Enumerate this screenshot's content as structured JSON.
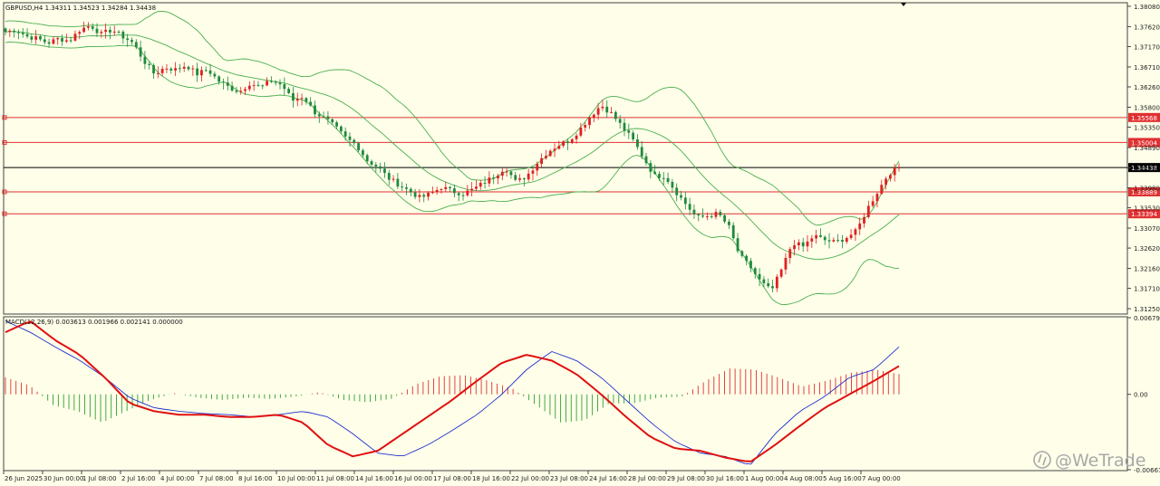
{
  "header": {
    "symbol_line": "GBPUSD,H4  1.34311 1.34523 1.34284 1.34438",
    "macd_line": "MACD(12,26,9) 0.003613 0.001966 0.002141 0.000000"
  },
  "watermark": {
    "text": "@WeTrade"
  },
  "colors": {
    "background": "#fefee9",
    "bull_candle": "#e02020",
    "bear_candle": "#1f8a3c",
    "bands": "#4caf50",
    "level_lines": "#e03030",
    "current_price_line": "#000000",
    "macd_line": "#2030d0",
    "signal_line": "#e01010",
    "hist_positive": "#e03030",
    "hist_negative": "#30a030"
  },
  "price_axis": {
    "ticks": [
      "1.38080",
      "1.37620",
      "1.37170",
      "1.36710",
      "1.36260",
      "1.35800",
      "1.35350",
      "1.34890",
      "1.34430",
      "1.33980",
      "1.33530",
      "1.33070",
      "1.32620",
      "1.32160",
      "1.31710",
      "1.31250"
    ]
  },
  "macd_axis": {
    "ticks": [
      "0.006791",
      "0.00",
      "-0.006674"
    ]
  },
  "time_axis": {
    "labels": [
      "26 Jun 2025",
      "30 Jun 00:00",
      "1 Jul 08:00",
      "2 Jul 16:00",
      "4 Jul 00:00",
      "7 Jul 08:00",
      "8 Jul 16:00",
      "10 Jul 00:00",
      "11 Jul 08:00",
      "14 Jul 16:00",
      "16 Jul 00:00",
      "17 Jul 08:00",
      "18 Jul 16:00",
      "22 Jul 00:00",
      "23 Jul 08:00",
      "24 Jul 16:00",
      "28 Jul 00:00",
      "29 Jul 08:00",
      "30 Jul 16:00",
      "1 Aug 00:00",
      "4 Aug 08:00",
      "5 Aug 16:00",
      "7 Aug 00:00"
    ]
  },
  "levels": [
    {
      "price": 1.35568,
      "label": "1.35568",
      "type": "resistance"
    },
    {
      "price": 1.35004,
      "label": "1.35004",
      "type": "resistance"
    },
    {
      "price": 1.34438,
      "label": "1.34438",
      "type": "current"
    },
    {
      "price": 1.33889,
      "label": "1.33889",
      "type": "support"
    },
    {
      "price": 1.33394,
      "label": "1.33394",
      "type": "support"
    }
  ],
  "chart_data": {
    "type": "candlestick",
    "symbol": "GBPUSD",
    "timeframe": "H4",
    "ylim": [
      1.3115,
      1.3814
    ],
    "close_path": [
      1.375,
      1.3755,
      1.374,
      1.3735,
      1.3725,
      1.3735,
      1.373,
      1.3755,
      1.3765,
      1.3745,
      1.3755,
      1.374,
      1.3725,
      1.3685,
      1.3655,
      1.367,
      1.3665,
      1.3675,
      1.3655,
      1.3665,
      1.364,
      1.3625,
      1.3615,
      1.3635,
      1.3625,
      1.364,
      1.363,
      1.3595,
      1.3605,
      1.357,
      1.3555,
      1.3535,
      1.351,
      1.3495,
      1.346,
      1.3445,
      1.342,
      1.3405,
      1.339,
      1.3375,
      1.3385,
      1.34,
      1.339,
      1.3385,
      1.3395,
      1.341,
      1.3425,
      1.3445,
      1.341,
      1.3425,
      1.3455,
      1.348,
      1.3495,
      1.3505,
      1.353,
      1.356,
      1.3585,
      1.3565,
      1.3535,
      1.3505,
      1.3465,
      1.3425,
      1.3425,
      1.339,
      1.336,
      1.333,
      1.3335,
      1.334,
      1.331,
      1.3245,
      1.322,
      1.3185,
      1.3165,
      1.3215,
      1.3275,
      1.3265,
      1.329,
      1.328,
      1.3275,
      1.3285,
      1.33,
      1.335,
      1.339,
      1.343,
      1.3444
    ],
    "bands_last": {
      "upper": 1.3337,
      "middle": 1.3336,
      "lower": 1.3215
    },
    "macd": {
      "fast": 12,
      "slow": 26,
      "signal": 9,
      "ylim": [
        -0.006674,
        0.006791
      ],
      "main_path": [
        0.0065,
        0.0055,
        0.0042,
        0.003,
        0.0015,
        -0.0003,
        -0.0012,
        -0.0015,
        -0.0017,
        -0.0018,
        -0.002,
        -0.0018,
        -0.0015,
        -0.002,
        -0.0035,
        -0.0052,
        -0.0055,
        -0.0045,
        -0.0032,
        -0.0018,
        0,
        0.0022,
        0.0038,
        0.003,
        0.0015,
        -0.0005,
        -0.0025,
        -0.0042,
        -0.0052,
        -0.0055,
        -0.0063,
        -0.0035,
        -0.0015,
        -0.0002,
        0.0015,
        0.0022,
        0.0042
      ],
      "signal_path": [
        0.0055,
        0.0065,
        0.0048,
        0.0035,
        0.0015,
        -0.0008,
        -0.0015,
        -0.0018,
        -0.0018,
        -0.002,
        -0.002,
        -0.0018,
        -0.0025,
        -0.0045,
        -0.0055,
        -0.005,
        -0.0035,
        -0.002,
        -0.0005,
        0.0012,
        0.0028,
        0.0035,
        0.003,
        0.0018,
        0,
        -0.002,
        -0.0038,
        -0.0048,
        -0.005,
        -0.0056,
        -0.006,
        -0.0045,
        -0.0028,
        -0.0012,
        0,
        0.0012,
        0.0025
      ],
      "hist_path": [
        0.0015,
        0.0008,
        -0.001,
        -0.0015,
        -0.0025,
        -0.0015,
        -0.0005,
        0.0001,
        -0.0003,
        -0.0005,
        -0.0003,
        -0.0004,
        -0.0002,
        0.0002,
        -0.0005,
        -0.0007,
        -0.0004,
        0.0009,
        0.0016,
        0.0017,
        0.0012,
        0.0005,
        -0.001,
        -0.0025,
        -0.0023,
        -0.0008,
        -0.0008,
        -0.0003,
        -0.0002,
        0.0012,
        0.0023,
        0.0022,
        0.0015,
        0.0007,
        0.0012,
        0.0019,
        0.0022,
        0.0018
      ]
    }
  }
}
